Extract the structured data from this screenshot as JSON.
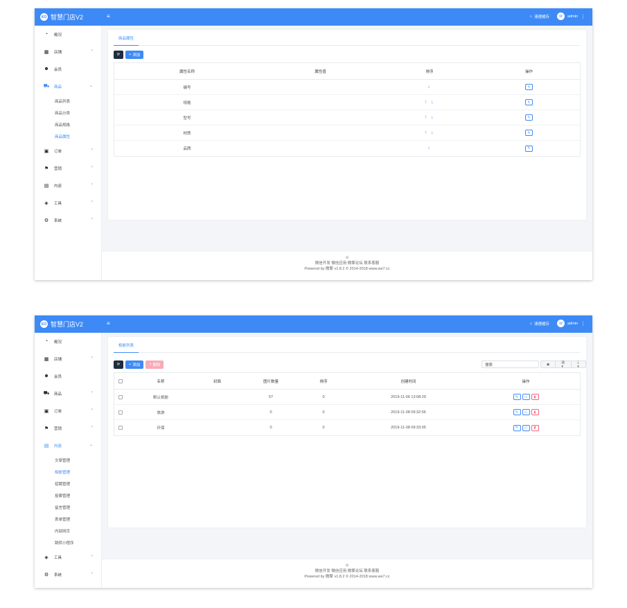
{
  "app": {
    "title": "智慧门店V2",
    "logo_text": "KO",
    "menu_icon": "≡",
    "clear_cache": "清理缓存",
    "user": "admin",
    "avatar_text": "W"
  },
  "nav_icons": {
    "overview": "dashboard-icon",
    "store": "grid-icon",
    "member": "users-icon",
    "goods": "cart-icon",
    "order": "money-icon",
    "marketing": "flag-icon",
    "content": "file-icon",
    "tools": "cube-icon",
    "system": "gear-icon"
  },
  "screen1": {
    "nav": [
      {
        "label": "概况"
      },
      {
        "label": "店铺"
      },
      {
        "label": "会员"
      },
      {
        "label": "商品"
      },
      {
        "label": "订单"
      },
      {
        "label": "营销"
      },
      {
        "label": "内容"
      },
      {
        "label": "工具"
      },
      {
        "label": "系统"
      }
    ],
    "sub_nav": [
      "商品列表",
      "商品分类",
      "商品规格",
      "商品属性"
    ],
    "tab": "商品属性",
    "add_label": "添加",
    "columns": [
      "属性名称",
      "属性值",
      "排序",
      "操作"
    ],
    "rows": [
      {
        "name": "编号",
        "value": "",
        "sort": "↓"
      },
      {
        "name": "规格",
        "value": "",
        "sort": "↑ ↓"
      },
      {
        "name": "型号",
        "value": "",
        "sort": "↑ ↓"
      },
      {
        "name": "材质",
        "value": "",
        "sort": "↑ ↓"
      },
      {
        "name": "品牌",
        "value": "",
        "sort": "↑"
      }
    ]
  },
  "screen2": {
    "nav": [
      {
        "label": "概况"
      },
      {
        "label": "店铺"
      },
      {
        "label": "会员"
      },
      {
        "label": "商品"
      },
      {
        "label": "订单"
      },
      {
        "label": "营销"
      },
      {
        "label": "内容"
      },
      {
        "label": "工具"
      },
      {
        "label": "系统"
      }
    ],
    "sub_nav": [
      "文章管理",
      "相册管理",
      "招聘管理",
      "投票管理",
      "留言管理",
      "表单管理",
      "内部网页",
      "跳转小程序"
    ],
    "tab": "相册列表",
    "add_label": "添加",
    "delete_label": "删除",
    "search_value": "搜索",
    "columns": [
      "名称",
      "封面",
      "图片数量",
      "排序",
      "创建时间",
      "操作"
    ],
    "rows": [
      {
        "name": "默认相册",
        "cover": "",
        "count": "57",
        "order": "0",
        "created": "2019-11-06 13:08:29"
      },
      {
        "name": "旅游",
        "cover": "",
        "count": "0",
        "order": "0",
        "created": "2019-11-08 09:32:56"
      },
      {
        "name": "环保",
        "cover": "",
        "count": "0",
        "order": "0",
        "created": "2019-11-08 09:33:05"
      }
    ]
  },
  "footer": {
    "mark": "⊙",
    "links": "微信开发 微信应用 微擎论坛 联系客服",
    "powered": "Powered by 微擎 v1.8.2 © 2014-2018 www.we7.cc"
  }
}
